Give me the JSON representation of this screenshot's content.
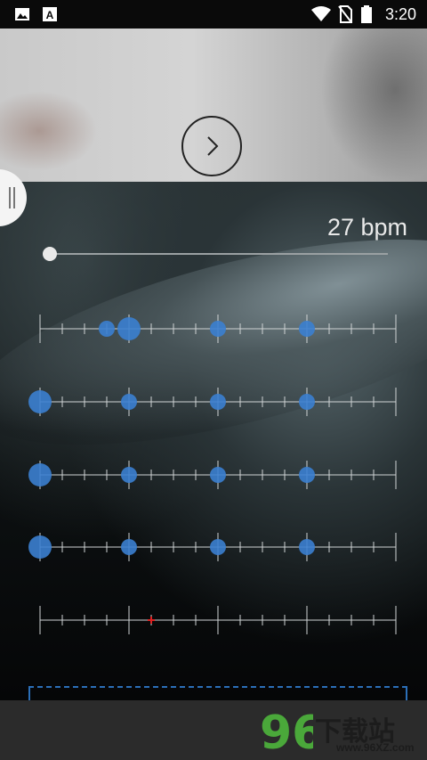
{
  "status_bar": {
    "time": "3:20",
    "icons": [
      "image-icon",
      "a-icon",
      "wifi-icon",
      "no-sim-icon",
      "battery-icon"
    ]
  },
  "top_panel": {
    "next_icon": "chevron-right-icon"
  },
  "drawer_handle_icon": "drag-handle-icon",
  "tempo": {
    "bpm_label": "27 bpm",
    "slider_fraction": 0.0
  },
  "pattern": {
    "rows": [
      {
        "name": "row-1",
        "beats": [
          3,
          4,
          8,
          12
        ],
        "accent_beats": [
          4
        ]
      },
      {
        "name": "row-2",
        "beats": [
          0,
          4,
          8,
          12
        ],
        "accent_beats": [
          0
        ]
      },
      {
        "name": "row-3",
        "beats": [
          0,
          4,
          8,
          12
        ],
        "accent_beats": [
          0
        ]
      },
      {
        "name": "row-4",
        "beats": [
          0,
          4,
          8,
          12
        ],
        "accent_beats": [
          0
        ]
      },
      {
        "name": "row-5",
        "beats": [],
        "accent_beats": [],
        "marker_beat": 5
      }
    ],
    "steps": 17,
    "dot_color": "#3b7fd0",
    "marker_color": "#e02020"
  },
  "watermark": {
    "logo_text": "96",
    "title": "下载站",
    "subtitle": "www.96XZ.com"
  }
}
